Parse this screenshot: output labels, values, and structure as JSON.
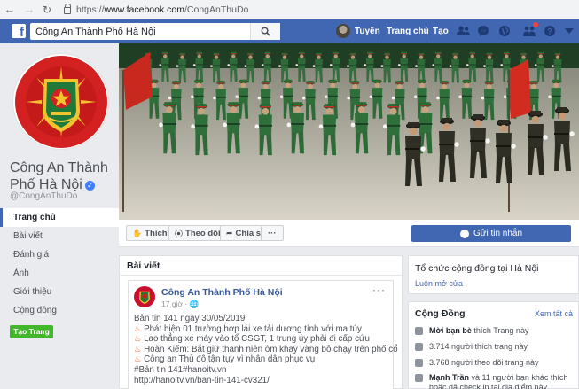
{
  "browser": {
    "scheme": "https://",
    "domain": "www.facebook.com",
    "path": "/CongAnThuDo"
  },
  "topbar": {
    "search_value": "Công An Thành Phố Hà Nội",
    "user_name": "Tuyến",
    "home_label": "Trang chủ",
    "create_label": "Tạo",
    "brand_color": "#4267b2"
  },
  "page": {
    "name": "Công An Thành Phố Hà Nội",
    "handle": "@CongAnThuDo"
  },
  "left_nav": {
    "items": [
      {
        "label": "Trang chủ",
        "active": true
      },
      {
        "label": "Bài viết"
      },
      {
        "label": "Đánh giá"
      },
      {
        "label": "Ảnh"
      },
      {
        "label": "Giới thiệu"
      },
      {
        "label": "Cộng đồng"
      }
    ],
    "create_page": "Tạo Trang"
  },
  "actions": {
    "like": "Thích",
    "follow": "Theo dõi",
    "share": "Chia sẻ",
    "more": "···",
    "message": "Gửi tin nhắn"
  },
  "posts": {
    "header": "Bài viết",
    "post": {
      "author": "Công An Thành Phố Hà Nội",
      "date": "17 giờ ·",
      "title": "Bản tin 141 ngày 30/05/2019",
      "items": [
        "Phát hiện 01 trường hợp lái xe tải dương tính với ma túy",
        "Lao thẳng xe máy vào tổ CSGT, 1 trung úy phải đi cấp cứu",
        "Hoàn Kiếm: Bắt giữ thanh niên ôm khay vàng bỏ chạy trên phố cổ",
        "Công an Thủ đô tận tụy vì nhân dân phục vụ"
      ],
      "tags": "#Bản tin 141#hanoitv.vn",
      "link": "http://hanoitv.vn/ban-tin-141-cv321/"
    }
  },
  "right": {
    "category": "Tổ chức cộng đồng tại Hà Nội",
    "status": "Luôn mở cửa",
    "community": {
      "title": "Cộng Đồng",
      "see_all": "Xem tất cả",
      "invite_bold": "Mời bạn bè",
      "invite_rest": " thích Trang này",
      "likes": "3.714 người thích trang này",
      "followers": "3.768 người theo dõi trang này",
      "friends_bold": "Mạnh Trần",
      "friends_rest": " và 11 người bạn khác thích hoặc đã check in tại địa điểm này"
    }
  }
}
